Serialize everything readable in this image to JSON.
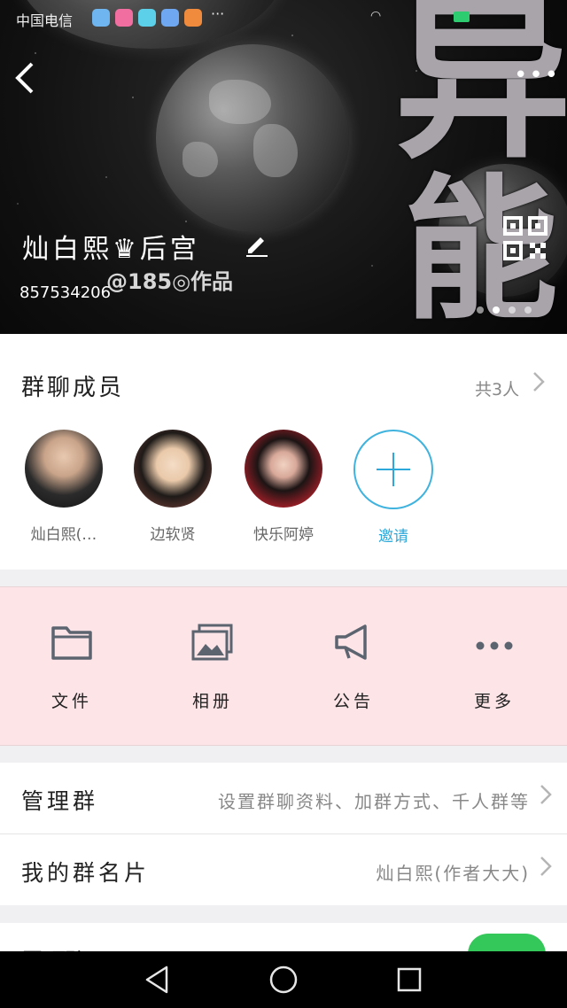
{
  "status_bar": {
    "carrier": "中国电信",
    "more": "···"
  },
  "header": {
    "group_name": "灿白熙♛后宫",
    "watermark": "@185◎作品",
    "group_id": "857534206",
    "bg_glyphs": [
      "异",
      "能"
    ],
    "back_icon": "back-arrow-icon",
    "more_label": "•••"
  },
  "members": {
    "title": "群聊成员",
    "count": "共3人",
    "list": [
      {
        "name": "灿白熙(…"
      },
      {
        "name": "边软贤"
      },
      {
        "name": "快乐阿婷"
      }
    ],
    "invite_label": "邀请"
  },
  "actions": [
    {
      "label": "文件",
      "icon": "folder-icon"
    },
    {
      "label": "相册",
      "icon": "album-icon"
    },
    {
      "label": "公告",
      "icon": "megaphone-icon"
    },
    {
      "label": "更多",
      "icon": "more-dots-icon"
    }
  ],
  "settings": {
    "manage_title": "管理群",
    "manage_value": "设置群聊资料、加群方式、千人群等",
    "card_title": "我的群名片",
    "card_value": "灿白熙(作者大大)",
    "partial_title": "置顶聊天"
  },
  "colors": {
    "accent": "#2ca8da",
    "actions_bg": "#fde4e7",
    "toggle_on": "#34c759"
  }
}
